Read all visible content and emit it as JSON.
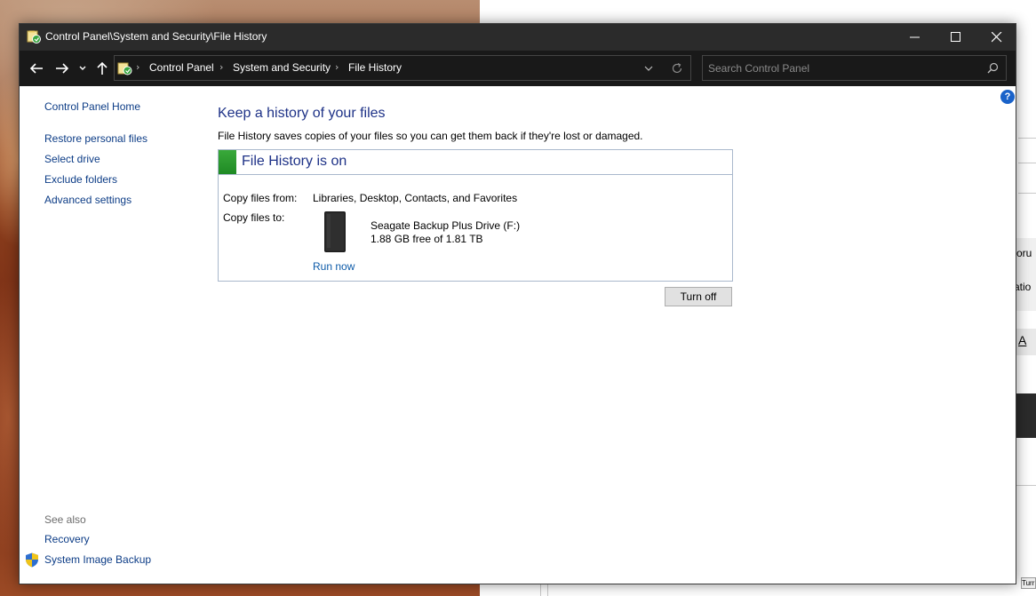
{
  "window": {
    "title": "Control Panel\\System and Security\\File History"
  },
  "navigation": {
    "breadcrumbs": [
      "Control Panel",
      "System and Security",
      "File History"
    ],
    "search_placeholder": "Search Control Panel"
  },
  "help": {
    "label": "?"
  },
  "sidebar": {
    "home_link": "Control Panel Home",
    "tasks": [
      "Restore personal files",
      "Select drive",
      "Exclude folders",
      "Advanced settings"
    ],
    "see_also_label": "See also",
    "see_also_links": [
      "Recovery",
      "System Image Backup"
    ]
  },
  "main": {
    "heading": "Keep a history of your files",
    "description": "File History saves copies of your files so you can get them back if they're lost or damaged.",
    "status": {
      "title": "File History is on",
      "copy_from_label": "Copy files from:",
      "copy_from_value": "Libraries, Desktop, Contacts, and Favorites",
      "copy_to_label": "Copy files to:",
      "drive_name": "Seagate Backup Plus Drive (F:)",
      "drive_space": "1.88 GB free of 1.81 TB",
      "run_now": "Run now",
      "status_color": "#2e9f33"
    },
    "turn_off_button": "Turn off"
  },
  "background_window": {
    "fragments": [
      "oru",
      "atio",
      "A",
      "Turr"
    ]
  },
  "icons": {
    "title": "file-history-icon",
    "back": "arrow-left-icon",
    "forward": "arrow-right-icon",
    "recent": "chevron-down-icon",
    "up": "arrow-up-icon",
    "refresh": "refresh-icon",
    "search": "search-icon",
    "shield": "shield-icon",
    "drive": "external-drive-icon"
  }
}
